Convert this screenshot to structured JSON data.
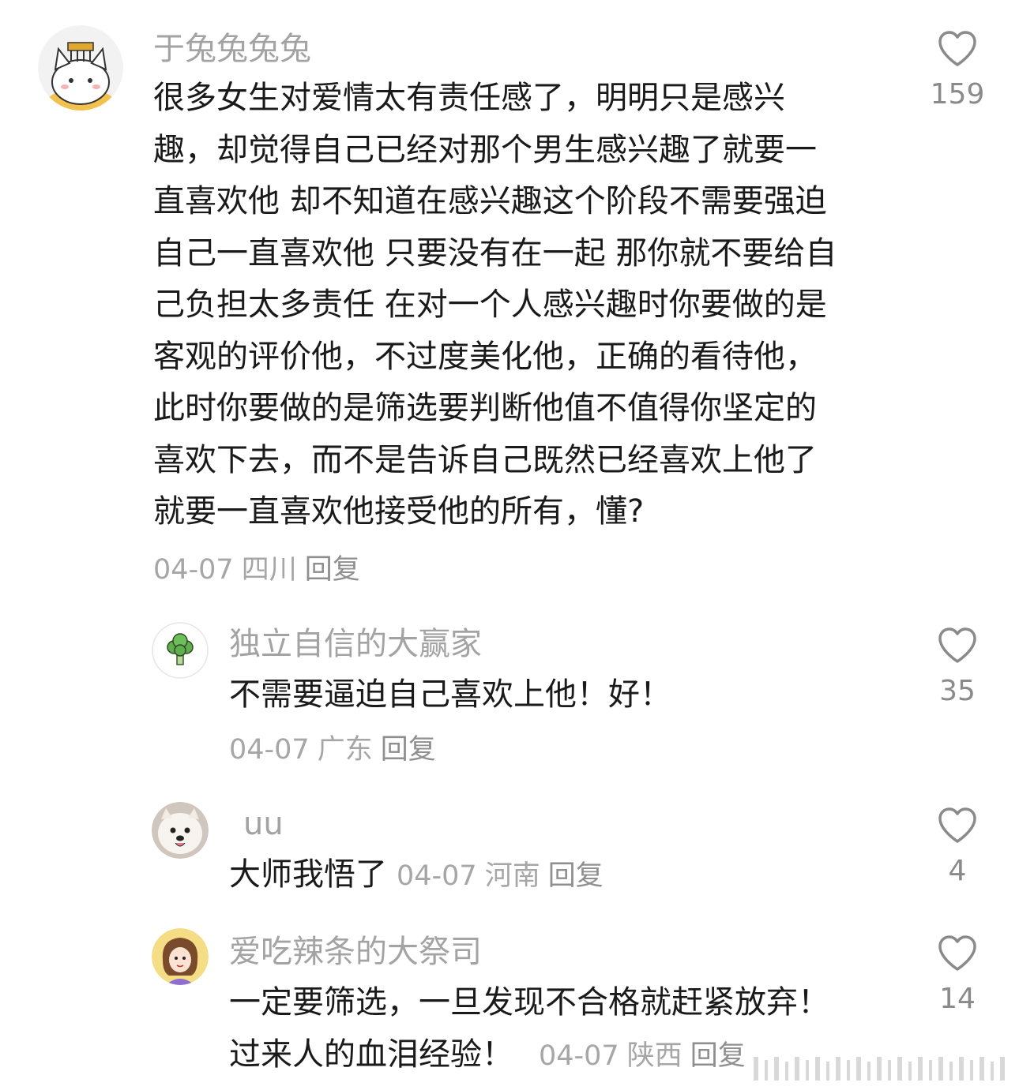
{
  "comments": [
    {
      "username": "于兔兔兔兔",
      "lines": [
        "很多女生对爱情太有责任感了，明明只是感兴",
        "趣，却觉得自己已经对那个男生感兴趣了就要一",
        "直喜欢他  却不知道在感兴趣这个阶段不需要强迫",
        "自己一直喜欢他 只要没有在一起 那你就不要给自",
        "己负担太多责任  在对一个人感兴趣时你要做的是",
        "客观的评价他，不过度美化他，正确的看待他，",
        "此时你要做的是筛选要判断他值不值得你坚定的",
        "喜欢下去，而不是告诉自己既然已经喜欢上他了",
        "就要一直喜欢他接受他的所有，懂?"
      ],
      "date": "04-07",
      "location": "四川",
      "reply_label": "回复",
      "likes": "159",
      "avatar_icon": "cat-emperor-avatar"
    }
  ],
  "replies": [
    {
      "username": "独立自信的大赢家",
      "lines": [
        "不需要逼迫自己喜欢上他！好！"
      ],
      "date": "04-07",
      "location": "广东",
      "reply_label": "回复",
      "likes": "35",
      "avatar_icon": "broccoli-avatar"
    },
    {
      "username": "uu",
      "text": "大师我悟了",
      "date": "04-07",
      "location": "河南",
      "reply_label": "回复",
      "likes": "4",
      "avatar_icon": "samoyed-dog-avatar"
    },
    {
      "username": "爱吃辣条的大祭司",
      "line1": "一定要筛选，一旦发现不合格就赶紧放弃！",
      "line2": "过来人的血泪经验！",
      "date": "04-07",
      "location": "陕西",
      "reply_label": "回复",
      "likes": "14",
      "avatar_icon": "cartoon-girl-avatar"
    }
  ],
  "colors": {
    "text": "#1a1a1a",
    "muted": "#a3a3a3",
    "icon": "#8a8a8a"
  },
  "icons": {
    "like": "heart-outline-icon"
  }
}
